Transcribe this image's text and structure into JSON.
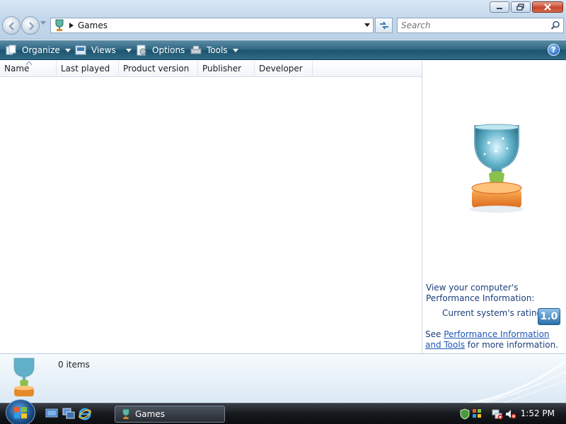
{
  "window": {
    "buttons": [
      "minimize",
      "maximize",
      "close"
    ]
  },
  "address": {
    "crumb": "Games"
  },
  "search": {
    "placeholder": "Search"
  },
  "toolbar": {
    "items": [
      {
        "label": "Organize",
        "icon": "organize-icon",
        "has_dropdown": true
      },
      {
        "label": "Views",
        "icon": "views-icon",
        "has_dropdown": true
      },
      {
        "label": "Options",
        "icon": "options-icon",
        "has_dropdown": false
      },
      {
        "label": "Tools",
        "icon": "tools-icon",
        "has_dropdown": true
      }
    ],
    "help_label": "?"
  },
  "columns": [
    "Name",
    "Last played",
    "Product version",
    "Publisher",
    "Developer"
  ],
  "side_panel": {
    "perf_text": "View your computer's Performance Information:",
    "rating_label": "Current system's rating:",
    "rating_value": "1.0",
    "see_prefix": "See ",
    "see_link": "Performance Information and Tools",
    "see_suffix": " for more information."
  },
  "details": {
    "count": "0 items"
  },
  "taskbar": {
    "task_label": "Games",
    "clock": "1:52 PM"
  },
  "colors": {
    "command_bar": "#2e6682",
    "link": "#1c55b8",
    "side_text": "#1b3e7a",
    "close_button": "#c7462a"
  }
}
